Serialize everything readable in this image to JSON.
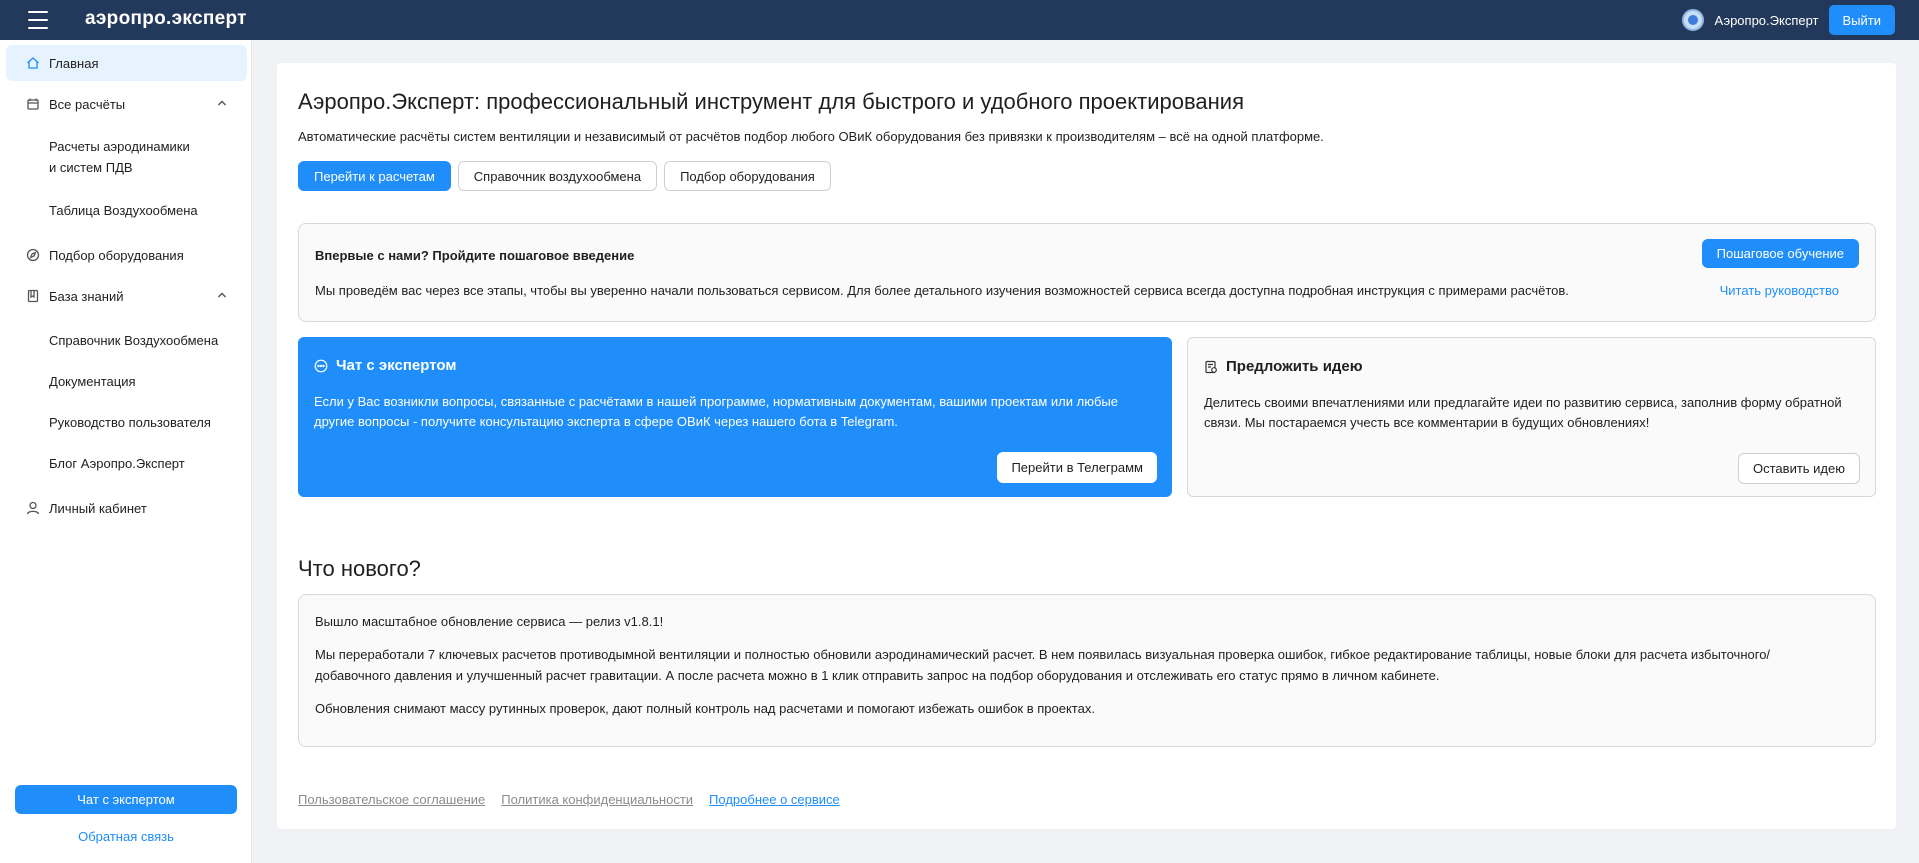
{
  "header": {
    "logo": "аэропро.эксперт",
    "username": "Аэропро.Эксперт",
    "logout_label": "Выйти"
  },
  "sidebar": {
    "home": "Главная",
    "all_calcs": "Все расчёты",
    "sub_calcs": [
      "Расчеты аэродинамики",
      "и систем ПДВ",
      "Таблица Воздухообмена"
    ],
    "equipment": "Подбор оборудования",
    "knowledge": "База знаний",
    "sub_knowledge": [
      "Справочник Воздухообмена",
      "Документация",
      "Руководство пользователя",
      "Блог Аэропро.Эксперт"
    ],
    "account": "Личный кабинет",
    "chat_button": "Чат с экспертом",
    "feedback_link": "Обратная связь"
  },
  "main": {
    "title": "Аэропро.Эксперт: профессиональный инструмент для быстрого и удобного проектирования",
    "subtitle": "Автоматические расчёты систем вентиляции и независимый от расчётов подбор любого ОВиК оборудования без привязки к производителям – всё на одной платформе.",
    "buttons": [
      "Перейти к расчетам",
      "Справочник воздухообмена",
      "Подбор оборудования"
    ],
    "intro": {
      "title": "Впервые с нами? Пройдите пошаговое введение",
      "text": "Мы проведём вас через все этапы, чтобы вы уверенно начали пользоваться сервисом. Для более детального изучения возможностей сервиса всегда доступна подробная инструкция с примерами расчётов.",
      "button": "Пошаговое обучение",
      "link": "Читать руководство"
    },
    "chat_card": {
      "title": "Чат с экспертом",
      "text": "Если у Вас возникли вопросы, связанные с расчётами в нашей программе, нормативным документам, вашими проектам или любые другие вопросы - получите консультацию эксперта в сфере ОВиК через нашего бота в Telegram.",
      "button": "Перейти в Телеграмм"
    },
    "idea_card": {
      "title": "Предложить идею",
      "text": "Делитесь своими впечатлениями или предлагайте идеи по развитию сервиса, заполнив форму обратной связи. Мы постараемся учесть все комментарии в будущих обновлениях!",
      "button": "Оставить идею"
    },
    "news": {
      "title": "Что нового?",
      "p1": "Вышло масштабное обновление сервиса — релиз v1.8.1!",
      "p2a": "Мы переработали 7 ключевых расчетов противодымной вентиляции и полностью обновили аэродинамический расчет. В нем появилась визуальная проверка ошибок, гибкое редактирование таблицы, новые блоки для расчета избыточного/",
      "p2b": "добавочного давления и улучшенный расчет гравитации. А после расчета можно в 1 клик отправить запрос на подбор оборудования и отслеживать его статус прямо в личном кабинете.",
      "p3": "Обновления снимают массу рутинных проверок, дают полный контроль над расчетами и помогают избежать ошибок в проектах."
    },
    "footer": [
      "Пользовательское соглашение",
      "Политика конфиденциальности",
      "Подробнее о сервисе"
    ]
  },
  "colors": {
    "header_bg": "#23395b",
    "accent": "#1f8efa",
    "active_bg": "#e6f3ff"
  }
}
